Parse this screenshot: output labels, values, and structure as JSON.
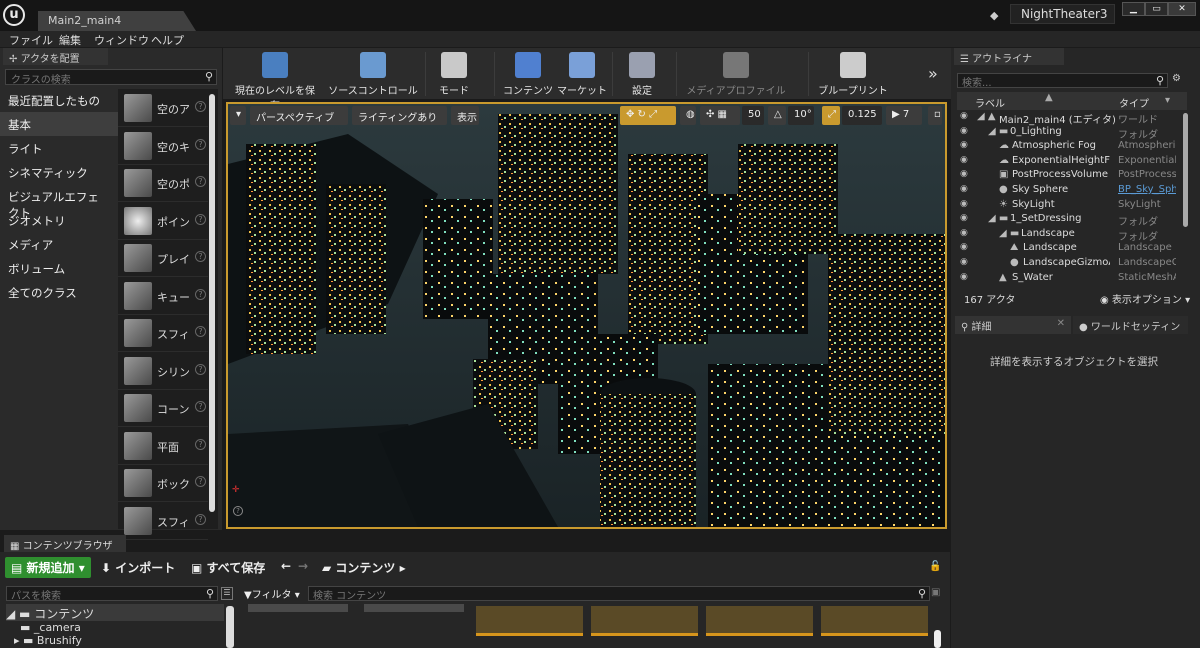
{
  "title_bar": {
    "tab": "Main2_main4",
    "project": "NightTheater3"
  },
  "menu": [
    "ファイル",
    "編集",
    "ウィンドウ",
    "ヘルプ"
  ],
  "place_actors": {
    "tab": "アクタを配置",
    "search_placeholder": "クラスの検索",
    "categories": [
      "最近配置したもの",
      "基本",
      "ライト",
      "シネマティック",
      "ビジュアルエフェクト",
      "ジオメトリ",
      "メディア",
      "ボリューム",
      "全てのクラス"
    ],
    "selected_category": "基本",
    "assets": [
      "空のア",
      "空のキ",
      "空のポ",
      "ポイン",
      "プレイ",
      "キュー",
      "スフィ",
      "シリン",
      "コーン",
      "平面",
      "ボック",
      "スフィ"
    ]
  },
  "toolbar": [
    "現在のレベルを保存",
    "ソースコントロール",
    "モード",
    "コンテンツ",
    "マーケット",
    "設定",
    "メディアプロファイル",
    "ブループリント"
  ],
  "viewport": {
    "perspective": "パースペクティブ",
    "lighting": "ライティングあり",
    "show": "表示",
    "grid_snap": "50",
    "rotation_snap": "10°",
    "scale_snap": "0.125",
    "camera_speed": "7"
  },
  "outliner": {
    "tab": "アウトライナ",
    "search_placeholder": "検索...",
    "col_label": "ラベル",
    "col_type": "タイプ",
    "rows": [
      {
        "name": "Main2_main4 (エディタ)",
        "type": "ワールド",
        "indent": 0
      },
      {
        "name": "0_Lighting",
        "type": "フォルダ",
        "indent": 1
      },
      {
        "name": "Atmospheric Fog",
        "type": "AtmosphericF",
        "indent": 2
      },
      {
        "name": "ExponentialHeightFog",
        "type": "ExponentialH",
        "indent": 2
      },
      {
        "name": "PostProcessVolume",
        "type": "PostProcessV",
        "indent": 2
      },
      {
        "name": "Sky Sphere",
        "type": "BP_Sky_Sph",
        "indent": 2,
        "link": true
      },
      {
        "name": "SkyLight",
        "type": "SkyLight",
        "indent": 2
      },
      {
        "name": "1_SetDressing",
        "type": "フォルダ",
        "indent": 1
      },
      {
        "name": "Landscape",
        "type": "フォルダ",
        "indent": 2
      },
      {
        "name": "Landscape",
        "type": "Landscape",
        "indent": 3
      },
      {
        "name": "LandscapeGizmoAc",
        "type": "LandscapeGiz",
        "indent": 3
      },
      {
        "name": "S_Water",
        "type": "StaticMeshAc",
        "indent": 2
      }
    ],
    "actor_count": "167 アクタ",
    "view_options": "表示オプション"
  },
  "details": {
    "tab": "詳細",
    "world_tab": "ワールドセッティン",
    "message": "詳細を表示するオブジェクトを選択"
  },
  "content_browser": {
    "tab": "コンテンツブラウザ",
    "add_new": "新規追加",
    "import": "インポート",
    "save_all": "すべて保存",
    "path": "コンテンツ",
    "path_search_placeholder": "パスを検索",
    "filter": "フィルタ",
    "search_placeholder": "検索 コンテンツ",
    "tree": [
      "コンテンツ",
      "_camera",
      "Brushify"
    ]
  },
  "colors": {
    "accent": "#c99a2e",
    "add_new": "#2f8f2f",
    "folder_asset": "#d6951c"
  }
}
